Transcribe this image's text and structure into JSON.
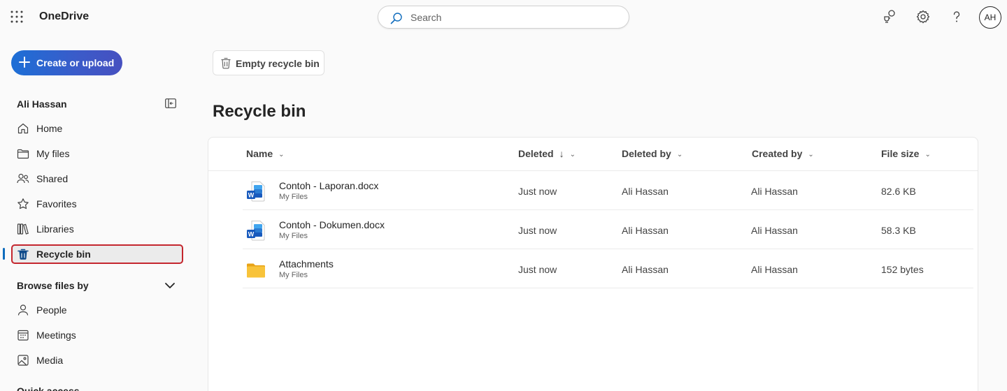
{
  "app": {
    "title": "OneDrive"
  },
  "search": {
    "placeholder": "Search"
  },
  "user": {
    "initials": "AH",
    "name": "Ali Hassan"
  },
  "create_button": {
    "label": "Create or upload"
  },
  "nav": {
    "items": [
      {
        "label": "Home",
        "icon": "home-icon"
      },
      {
        "label": "My files",
        "icon": "folder-icon"
      },
      {
        "label": "Shared",
        "icon": "people-icon"
      },
      {
        "label": "Favorites",
        "icon": "star-icon"
      },
      {
        "label": "Libraries",
        "icon": "libraries-icon"
      },
      {
        "label": "Recycle bin",
        "icon": "trash-icon",
        "selected": true
      }
    ]
  },
  "browse": {
    "title": "Browse files by",
    "items": [
      {
        "label": "People",
        "icon": "person-icon"
      },
      {
        "label": "Meetings",
        "icon": "calendar-icon"
      },
      {
        "label": "Media",
        "icon": "image-icon"
      }
    ]
  },
  "quick_access": {
    "title": "Quick access"
  },
  "toolbar": {
    "empty_label": "Empty recycle bin"
  },
  "page": {
    "title": "Recycle bin"
  },
  "table": {
    "columns": {
      "name": "Name",
      "deleted": "Deleted",
      "deleted_by": "Deleted by",
      "created_by": "Created by",
      "file_size": "File size"
    },
    "rows": [
      {
        "name": "Contoh - Laporan.docx",
        "location": "My Files",
        "deleted": "Just now",
        "deleted_by": "Ali Hassan",
        "created_by": "Ali Hassan",
        "size": "82.6 KB",
        "type": "word"
      },
      {
        "name": "Contoh - Dokumen.docx",
        "location": "My Files",
        "deleted": "Just now",
        "deleted_by": "Ali Hassan",
        "created_by": "Ali Hassan",
        "size": "58.3 KB",
        "type": "word"
      },
      {
        "name": "Attachments",
        "location": "My Files",
        "deleted": "Just now",
        "deleted_by": "Ali Hassan",
        "created_by": "Ali Hassan",
        "size": "152 bytes",
        "type": "folder"
      }
    ]
  },
  "colors": {
    "accent": "#0f6cbd",
    "selection_outline": "#c4262e",
    "word_blue": "#185abd",
    "folder_yellow": "#f5b82e"
  }
}
